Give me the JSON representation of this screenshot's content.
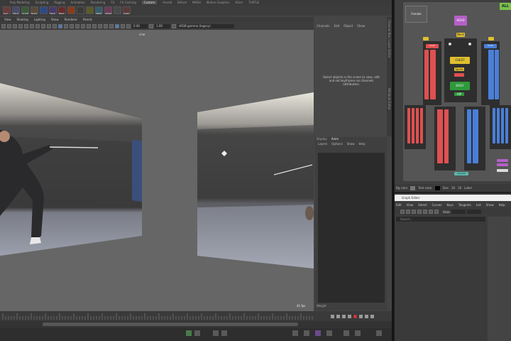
{
  "shelf_tabs": [
    "Poly Modeling",
    "Sculpting",
    "Rigging",
    "Animation",
    "Rendering",
    "FX",
    "FX Caching",
    "Custom",
    "Arnold",
    "Bifrost",
    "MASH",
    "Motion Graphics",
    "XGen",
    "TURTLE"
  ],
  "shelf_active": "Custom",
  "shelf_buttons": [
    "GLP",
    "SHLD",
    "STLMT",
    "BLKD",
    "",
    "FRCE",
    "BRKT",
    "",
    "",
    "",
    "SNAP",
    "APPLE",
    "",
    "GNRT"
  ],
  "viewport": {
    "menu": [
      "View",
      "Shading",
      "Lighting",
      "Show",
      "Renderer",
      "Panels"
    ],
    "value_a": "0.00",
    "value_b": "1.00",
    "camera_select": "sRGB gamma (legacy)",
    "camera_label": "char",
    "fps": "41 fps"
  },
  "channel_box": {
    "menu": [
      "Channels",
      "Edit",
      "Object",
      "Show"
    ],
    "message": "Select objects in the scene to view, edit and set keyframes on channels (attributes).",
    "side_tabs": [
      "Channel Box / Layer Editor",
      "Attribute Editor"
    ]
  },
  "layer_editor": {
    "tabs": [
      "Display",
      "Anim"
    ],
    "active_tab": "Anim",
    "menu": [
      "Layers",
      "Options",
      "Show",
      "Help"
    ],
    "footer": "Weight"
  },
  "picker": {
    "tab": "Female",
    "all": "ALL",
    "labels": {
      "head": "HEAD",
      "neck": "Neck",
      "clav_l": "CLAV",
      "clav_r": "CLAV",
      "chest": "CHEST",
      "body": "BODY",
      "hip": "HIP",
      "root": "Ground",
      "spine": "Spine"
    },
    "bottom": {
      "bg": "Bg color",
      "text": "Text color",
      "size": "Size",
      "w": "18",
      "h": "18",
      "label": "Label"
    }
  },
  "graph_editor": {
    "title": "Graph Editor",
    "menu": [
      "Edit",
      "View",
      "Select",
      "Curves",
      "Keys",
      "Tangents",
      "List",
      "Show",
      "Help"
    ],
    "stats": "Stats",
    "search": "Search..."
  },
  "colors": {
    "red": "#e05050",
    "blue": "#4a7fd8",
    "yellow": "#e0c030",
    "green": "#2e9a3a",
    "magenta": "#b460c8",
    "teal": "#5bb8a8"
  }
}
